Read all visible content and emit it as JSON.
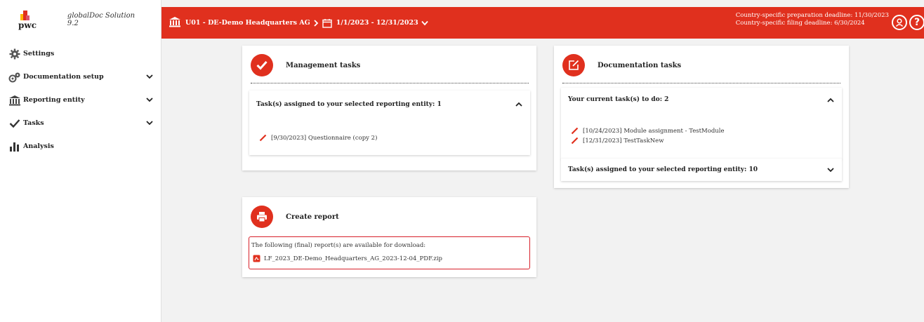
{
  "brand": {
    "logo_text": "pwc",
    "app_name": "globalDoc Solution 9.2"
  },
  "sidebar": {
    "items": [
      {
        "label": "Settings",
        "icon": "gear-icon",
        "expandable": false
      },
      {
        "label": "Documentation setup",
        "icon": "gears-icon",
        "expandable": true
      },
      {
        "label": "Reporting entity",
        "icon": "bank-icon",
        "expandable": true
      },
      {
        "label": "Tasks",
        "icon": "check-icon",
        "expandable": true
      },
      {
        "label": "Analysis",
        "icon": "bar-chart-icon",
        "expandable": false
      }
    ]
  },
  "topbar": {
    "entity": "U01 - DE-Demo Headquarters AG",
    "period": "1/1/2023 - 12/31/2023",
    "preparation_deadline": "Country-specific preparation deadline: 11/30/2023",
    "filing_deadline": "Country-specific filing deadline: 6/30/2024",
    "background": "#e0301e"
  },
  "management": {
    "title": "Management tasks",
    "section_title": "Task(s) assigned to your selected reporting entity: 1",
    "tasks": [
      "[9/30/2023] Questionnaire (copy 2)"
    ]
  },
  "documentation": {
    "title": "Documentation tasks",
    "current_title": "Your current task(s) to do: 2",
    "tasks": [
      "[10/24/2023] Module assignment - TestModule",
      "[12/31/2023] TestTaskNew"
    ],
    "assigned_title": "Task(s) assigned to your selected reporting entity: 10"
  },
  "report": {
    "title": "Create report",
    "intro": "The following (final) report(s) are available for download:",
    "file": "LF_2023_DE-Demo_Headquarters_AG_2023-12-04_PDF.zip"
  }
}
